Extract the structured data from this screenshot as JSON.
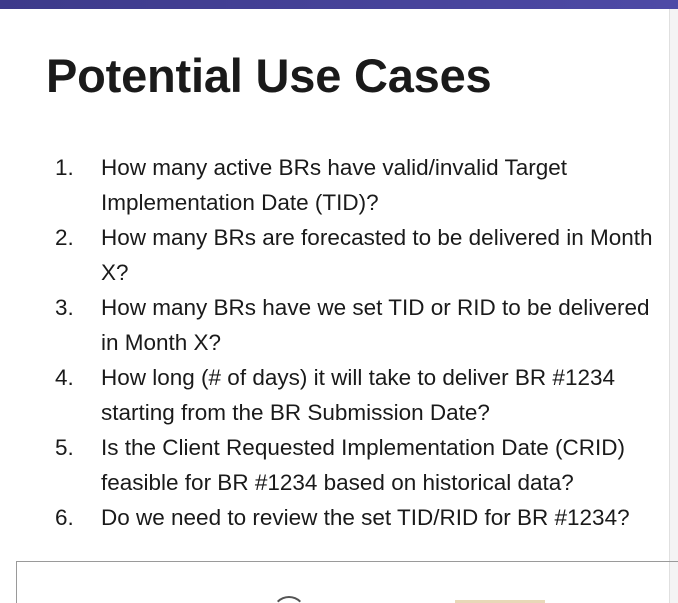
{
  "slide": {
    "title": "Potential Use Cases",
    "items": [
      {
        "number": "1.",
        "text": "How many active BRs have valid/invalid Target Implementation Date (TID)?"
      },
      {
        "number": "2.",
        "text": "How many BRs are forecasted to be delivered in Month X?"
      },
      {
        "number": "3.",
        "text": "How many BRs have we set TID or RID  to be delivered in Month X?"
      },
      {
        "number": "4.",
        "text": "How long (# of days) it will take to deliver BR #1234 starting from the BR Submission Date?"
      },
      {
        "number": "5.",
        "text": "Is the Client Requested Implementation Date (CRID) feasible for BR #1234 based on historical data?"
      },
      {
        "number": "6.",
        "text": "Do we need to review the set TID/RID for BR #1234?"
      }
    ]
  },
  "colors": {
    "accent_bar": "#3d3a8a",
    "text": "#1a1a1a"
  }
}
